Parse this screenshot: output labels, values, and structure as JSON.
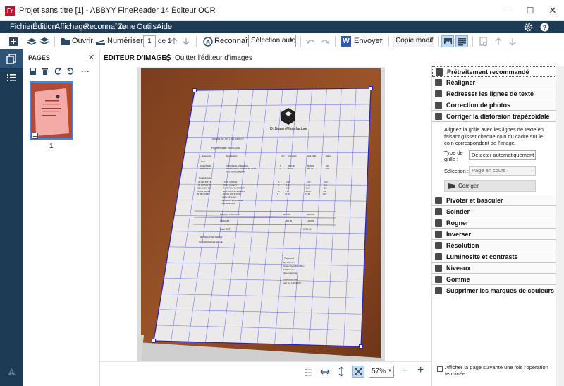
{
  "window": {
    "app_icon": "Fr",
    "title": "Projet sans titre [1] - ABBYY FineReader 14 Éditeur OCR",
    "minimize": "—",
    "maximize": "☐",
    "close": "✕"
  },
  "menu": [
    "Fichier",
    "Édition",
    "Affichage",
    "Reconnaître",
    "Zone",
    "Outils",
    "Aide"
  ],
  "toolbar": {
    "open_label": "Ouvrir",
    "scan_label": "Numériser",
    "page_value": "1",
    "page_of": "de 1",
    "recognize_label": "Reconnaître",
    "selection_mode": "Sélection autom",
    "send_label": "Envoyer",
    "copy_mode": "Copie modifié"
  },
  "pages_panel": {
    "title": "PAGES",
    "close": "✕",
    "more": "···",
    "thumbnail_number": "1"
  },
  "editor": {
    "title": "ÉDITEUR D'IMAGES",
    "back_label": "Quitter l'éditeur d'images",
    "zoom_value": "57%"
  },
  "invoice": {
    "company": "D. Brawn Manufacture",
    "invoice_no": "Invoice no. DVT-AX-249879",
    "payment_date": "Payment date: 05/10/2008",
    "headers": [
      "Reference",
      "Designation",
      "Qty",
      "Unit price",
      "Total CHF",
      "Sales"
    ],
    "section_fees": "Fees",
    "rows_a": [
      [
        "SERVICE D",
        "COMPLETE OVERHAUL",
        "1",
        "5500.00",
        "5500.00",
        "220"
      ],
      [
        "SERVICE D",
        "REFRESHING COMPLETE CASE",
        "1",
        "380.00",
        "380.00",
        "220"
      ],
      [
        "",
        "AND RHODIUM BATH",
        "",
        "",
        "",
        ""
      ]
    ],
    "section_parts": "Rotation parts",
    "rows_b": [
      [
        "JD 297 395 TF",
        "FLAT GASKET",
        "1",
        "3.00",
        "3.00",
        "220"
      ],
      [
        "JD 187 575 TF",
        "FLAT GASKET",
        "1",
        "4.00",
        "4.00",
        "220"
      ],
      [
        "JD 190 560 EN",
        "FLAT ROUND GASKET",
        "1",
        "8.00",
        "8.00",
        "220"
      ],
      [
        "JS 291 036 BC",
        "W.G.PLATION SCREWS",
        "10",
        "4.00",
        "40.00",
        "220"
      ],
      [
        "JS 456 023 BC",
        "WHITE GOLD \"FOIL\"",
        "1",
        "73.00",
        "73.00",
        "220"
      ],
      [
        "",
        "PAIR OF HAND",
        "",
        "",
        "",
        ""
      ],
      [
        "",
        "LENGTH : 10/12.60MM",
        "",
        "",
        "",
        ""
      ],
      [
        "",
        "CALIBRE 2068",
        "",
        "",
        "",
        ""
      ]
    ],
    "special_discount": "SPECIAL DISCOUNT",
    "special_discount_value": "-3003.00",
    "special_discount_total": "-3003.00",
    "discount": "Discount",
    "discount_value": "-800.00",
    "discount_total": "-800.00",
    "total_label": "Total CHF",
    "total_value": "2100.00",
    "note1": "RETURN AFTER REPAIR",
    "note2": "NO COMMERCIAL VALUE",
    "payment_title": "Payment",
    "payment_lines": [
      "Mr. John Doe",
      "Green Street 18, Office 4",
      "1234 Vienna",
      "New Caledonia"
    ],
    "card_lines": [
      "Credit Card Visa",
      "Card No. 112345678"
    ]
  },
  "right_panel": {
    "sections_top": [
      {
        "label": "Prétraitement recommandé",
        "icon": "preprocess-icon"
      },
      {
        "label": "Réaligner",
        "icon": "deskew-icon"
      },
      {
        "label": "Redresser les lignes de texte",
        "icon": "straighten-lines-icon"
      },
      {
        "label": "Correction de photos",
        "icon": "photo-correction-icon"
      },
      {
        "label": "Corriger la distorsion trapézoïdale",
        "icon": "trapezoid-icon"
      }
    ],
    "distortion_help": [
      "Alignez la grille avec les lignes de texte en",
      "faisant glisser chaque coin du cadre sur le",
      "coin correspondant de l'image."
    ],
    "grid_type_label": "Type de",
    "grid_type_label2": "grille :",
    "grid_type_value": "Détecter automatiquement",
    "selection_label": "Sélection :",
    "selection_value": "Page en cours",
    "correct_button": "Corriger",
    "sections_bottom": [
      {
        "label": "Pivoter et basculer",
        "icon": "rotate-icon"
      },
      {
        "label": "Scinder",
        "icon": "split-icon"
      },
      {
        "label": "Rogner",
        "icon": "crop-icon"
      },
      {
        "label": "Inverser",
        "icon": "invert-icon"
      },
      {
        "label": "Résolution",
        "icon": "resolution-icon"
      },
      {
        "label": "Luminosité et contraste",
        "icon": "brightness-icon"
      },
      {
        "label": "Niveaux",
        "icon": "levels-icon"
      },
      {
        "label": "Gomme",
        "icon": "eraser-icon"
      },
      {
        "label": "Supprimer les marques de couleurs",
        "icon": "remove-color-marks-icon"
      }
    ],
    "show_next_page": "Afficher la page suivante une fois l'opération",
    "show_next_page_2": "terminée"
  },
  "colors": {
    "navy": "#1e3b56",
    "accent_blue": "#2a5db0",
    "grid_blue": "#3040e0",
    "desk_brown": "#8a4a22"
  }
}
